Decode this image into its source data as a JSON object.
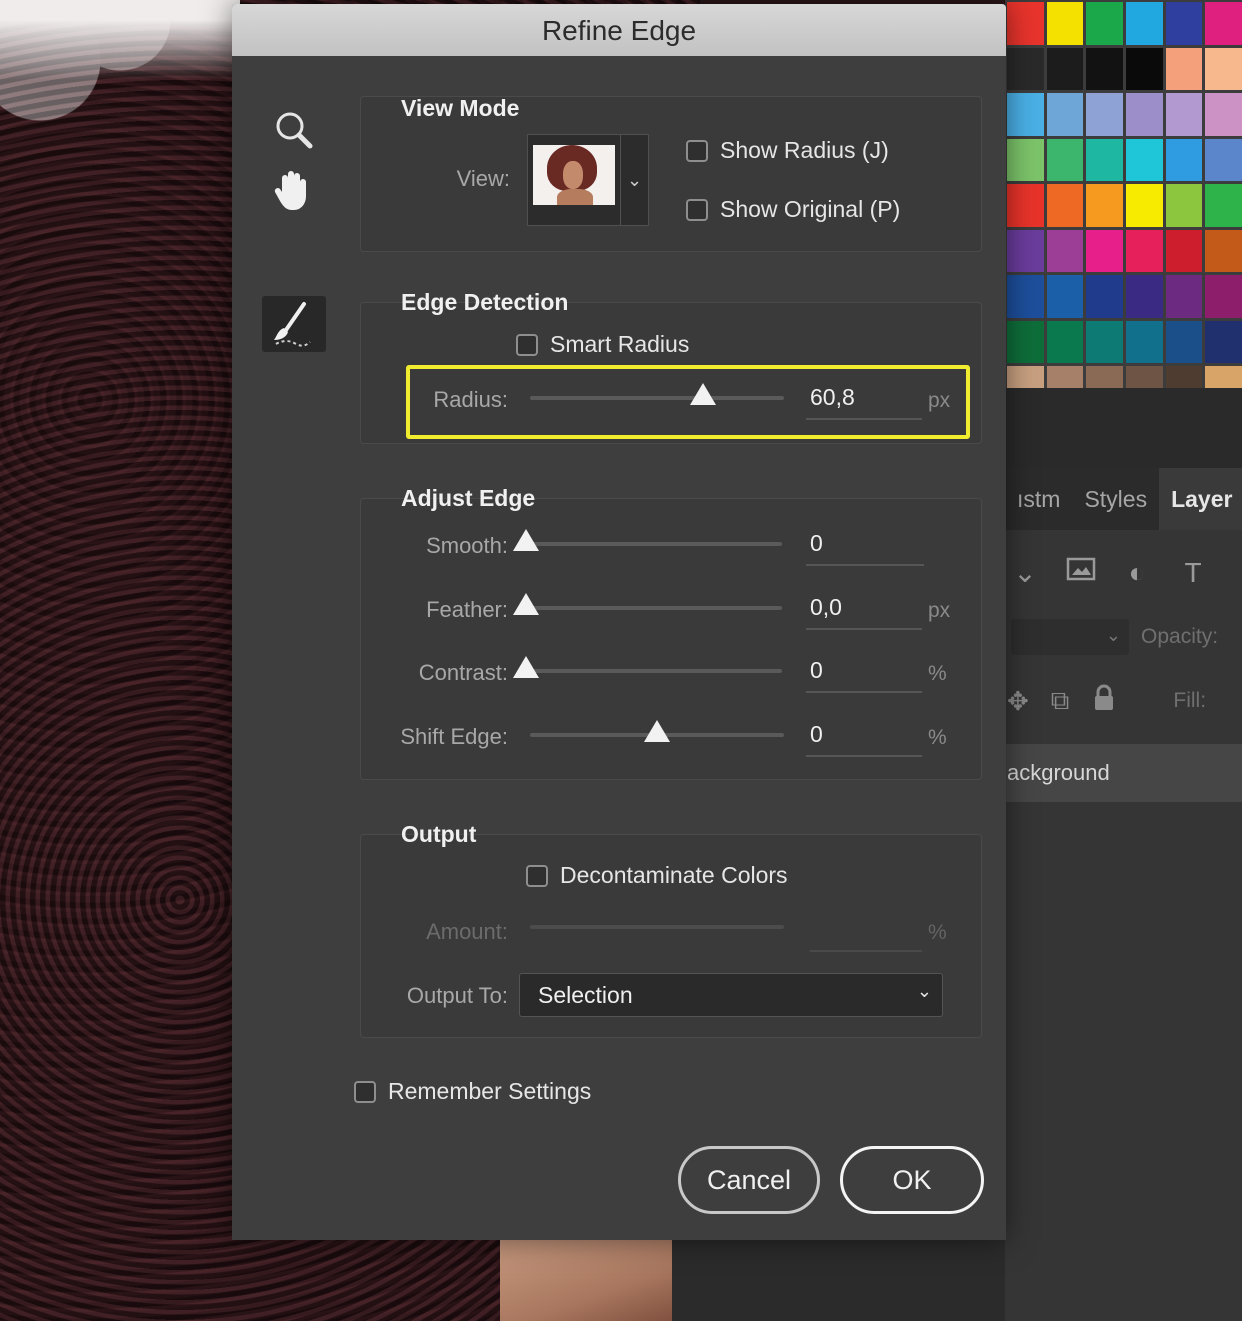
{
  "dialog": {
    "title": "Refine Edge",
    "view_mode": {
      "title": "View Mode",
      "view_label": "View:",
      "show_radius": {
        "label": "Show Radius (J)",
        "checked": false
      },
      "show_original": {
        "label": "Show Original (P)",
        "checked": false
      }
    },
    "edge_detection": {
      "title": "Edge Detection",
      "smart_radius": {
        "label": "Smart Radius",
        "checked": false
      },
      "radius": {
        "label": "Radius:",
        "value": "60,8",
        "unit": "px",
        "slider_fraction": 0.68
      }
    },
    "adjust_edge": {
      "title": "Adjust Edge",
      "smooth": {
        "label": "Smooth:",
        "value": "0",
        "unit": "",
        "slider_fraction": 0.0
      },
      "feather": {
        "label": "Feather:",
        "value": "0,0",
        "unit": "px",
        "slider_fraction": 0.0
      },
      "contrast": {
        "label": "Contrast:",
        "value": "0",
        "unit": "%",
        "slider_fraction": 0.0
      },
      "shift_edge": {
        "label": "Shift Edge:",
        "value": "0",
        "unit": "%",
        "slider_fraction": 0.5
      }
    },
    "output": {
      "title": "Output",
      "decontaminate": {
        "label": "Decontaminate Colors",
        "checked": false
      },
      "amount": {
        "label": "Amount:",
        "value": "",
        "unit": "%"
      },
      "output_to": {
        "label": "Output To:",
        "selected": "Selection"
      }
    },
    "remember_settings": {
      "label": "Remember Settings",
      "checked": false
    },
    "cancel_label": "Cancel",
    "ok_label": "OK"
  },
  "right_panel": {
    "tabs": [
      "ıstm",
      "Styles",
      "Layer"
    ],
    "opacity_label": "Opacity:",
    "fill_label": "Fill:",
    "layer_name": "ackground",
    "swatches": [
      "#e8342c",
      "#f5e100",
      "#1aa84a",
      "#21a8e0",
      "#2f3fa0",
      "#e0207e",
      "#2a2a2a",
      "#1c1c1c",
      "#121212",
      "#0a0a0a",
      "#f4a07a",
      "#f6b88c",
      "#4ab0e6",
      "#6ea6d8",
      "#8ea2d6",
      "#9c8ec8",
      "#b29ad0",
      "#cc92c6",
      "#7cc46a",
      "#3bb66c",
      "#1eb7a2",
      "#1ec6d8",
      "#2f9ce2",
      "#5c86cc",
      "#e8332a",
      "#ee6a24",
      "#f59a1e",
      "#f7ec00",
      "#8cc63e",
      "#2eb34a",
      "#6a3c9c",
      "#9c3d96",
      "#e61f8a",
      "#e6205a",
      "#cc1e2c",
      "#c45a1a",
      "#1d4f9c",
      "#1b5fa8",
      "#203a8c",
      "#3a2a84",
      "#6c2a80",
      "#8c1e6c",
      "#0e6e3a",
      "#0a7a4e",
      "#0e7a74",
      "#11708c",
      "#1a4f8a",
      "#20306e",
      "#c8a080",
      "#a68068",
      "#8a6a54",
      "#6e5444",
      "#4e3c30",
      "#d8a468"
    ]
  }
}
